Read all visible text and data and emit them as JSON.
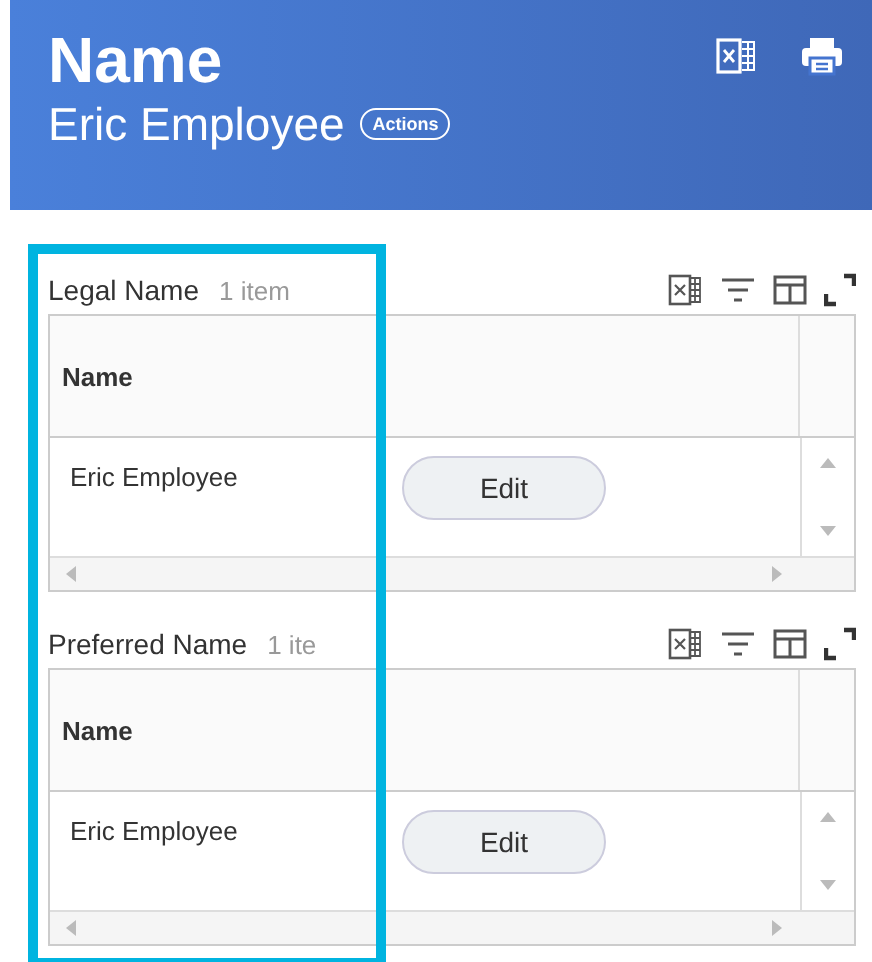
{
  "header": {
    "title": "Name",
    "subtitle": "Eric Employee",
    "actions_label": "Actions"
  },
  "sections": [
    {
      "title": "Legal Name",
      "count": "1 item",
      "column": "Name",
      "rows": [
        {
          "name": "Eric Employee",
          "action": "Edit"
        }
      ]
    },
    {
      "title": "Preferred Name",
      "count": "1 ite",
      "column": "Name",
      "rows": [
        {
          "name": "Eric Employee",
          "action": "Edit"
        }
      ]
    }
  ]
}
